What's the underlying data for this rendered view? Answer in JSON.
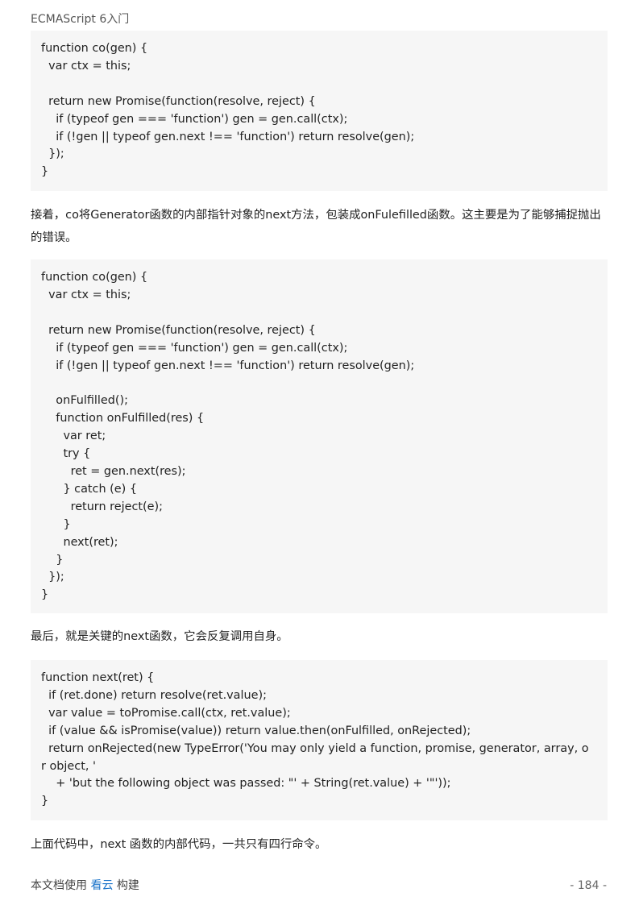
{
  "header": {
    "title": "ECMAScript 6入门"
  },
  "blocks": {
    "code1": "function co(gen) {\n  var ctx = this;\n\n  return new Promise(function(resolve, reject) {\n    if (typeof gen === 'function') gen = gen.call(ctx);\n    if (!gen || typeof gen.next !== 'function') return resolve(gen);\n  });\n}",
    "para1": "接着，co将Generator函数的内部指针对象的next方法，包装成onFulefilled函数。这主要是为了能够捕捉抛出的错误。",
    "code2": "function co(gen) {\n  var ctx = this;\n\n  return new Promise(function(resolve, reject) {\n    if (typeof gen === 'function') gen = gen.call(ctx);\n    if (!gen || typeof gen.next !== 'function') return resolve(gen);\n\n    onFulfilled();\n    function onFulfilled(res) {\n      var ret;\n      try {\n        ret = gen.next(res);\n      } catch (e) {\n        return reject(e);\n      }\n      next(ret);\n    }\n  });\n}",
    "para2": "最后，就是关键的next函数，它会反复调用自身。",
    "code3": "function next(ret) {\n  if (ret.done) return resolve(ret.value);\n  var value = toPromise.call(ctx, ret.value);\n  if (value && isPromise(value)) return value.then(onFulfilled, onRejected);\n  return onRejected(new TypeError('You may only yield a function, promise, generator, array, o\nr object, '\n    + 'but the following object was passed: \"' + String(ret.value) + '\"'));\n}",
    "para3": "上面代码中，next 函数的内部代码，一共只有四行命令。"
  },
  "footer": {
    "prefix": "本文档使用",
    "link": "看云",
    "suffix": "构建",
    "page_number": "- 184 -"
  }
}
